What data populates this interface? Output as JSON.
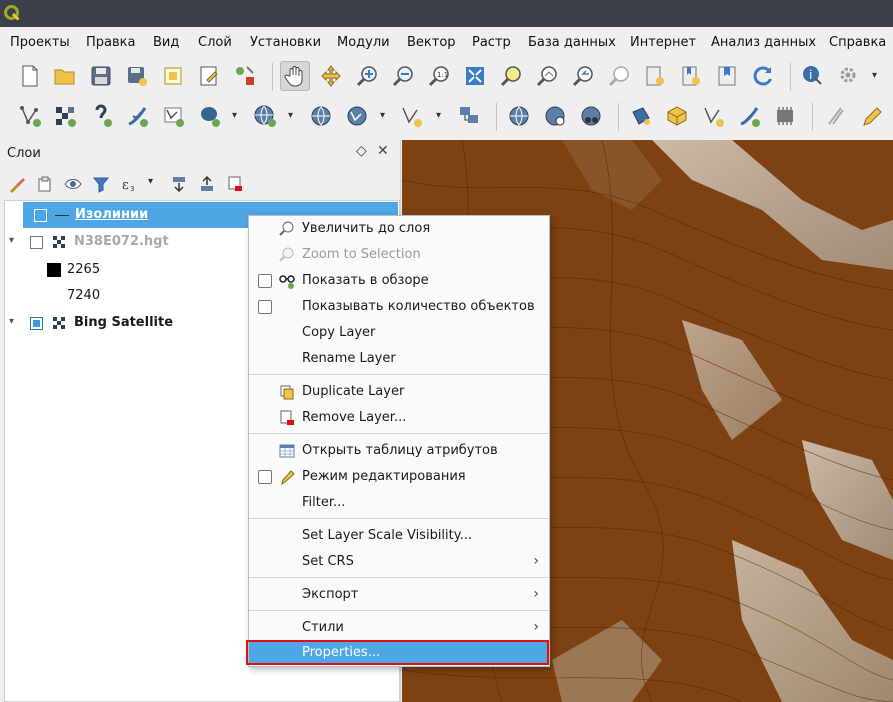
{
  "menubar": {
    "items": [
      "Проекты",
      "Правка",
      "Вид",
      "Слой",
      "Установки",
      "Модули",
      "Вектор",
      "Растр",
      "База данных",
      "Интернет",
      "Анализ данных",
      "Справка"
    ]
  },
  "toolbar1": {
    "icons": [
      "new-project-icon",
      "open-project-icon",
      "save-project-icon",
      "save-as-icon",
      "new-print-layout-icon",
      "layout-manager-icon",
      "style-manager-icon",
      "pan-icon",
      "pan-to-selection-icon",
      "zoom-in-icon",
      "zoom-out-icon",
      "zoom-native-icon",
      "zoom-full-icon",
      "zoom-selection-icon",
      "zoom-layer-icon",
      "zoom-last-icon",
      "zoom-next-icon",
      "new-bookmark-icon",
      "show-bookmarks-icon",
      "refresh-icon",
      "identify-icon",
      "settings-icon"
    ]
  },
  "toolbar2": {
    "icons": [
      "add-vector-layer-icon",
      "add-raster-layer-icon",
      "add-delimited-text-icon",
      "add-spatialite-icon",
      "add-virtual-layer-icon",
      "add-postgis-icon",
      "add-wms-icon",
      "add-wfs-icon",
      "add-wcs-icon",
      "add-wfs-layer-icon",
      "new-shapefile-icon",
      "add-xyz-icon",
      "add-ogc-api-icon",
      "add-arcgis-icon",
      "add-sensor-icon",
      "add-layer-definition-icon",
      "digitize-icon",
      "edit-icon",
      "toggle-editing-icon",
      "save-edits-icon",
      "digitize-line-icon"
    ]
  },
  "layers_panel": {
    "title": "Слои",
    "layers": [
      {
        "name": "Изолинии",
        "checked": false,
        "selected": true
      },
      {
        "name": "N38E072.hgt",
        "checked": false,
        "selected": false
      },
      {
        "name": "2265",
        "legend_color": "#000000"
      },
      {
        "name": "7240",
        "legend_color": "#ffffff"
      },
      {
        "name": "Bing Satellite",
        "checked": true,
        "selected": false
      }
    ]
  },
  "context_menu": {
    "items": [
      {
        "label": "Увеличить до слоя",
        "icon": "zoom-layer-icon"
      },
      {
        "label": "Zoom to Selection",
        "icon": "zoom-selection-icon",
        "disabled": true
      },
      {
        "label": "Показать в обзоре",
        "icon": "overview-icon",
        "checkbox": true
      },
      {
        "label": "Показывать количество объектов",
        "checkbox": true
      },
      {
        "label": "Copy Layer"
      },
      {
        "label": "Rename Layer"
      },
      {
        "label": "Duplicate Layer",
        "icon": "duplicate-layer-icon"
      },
      {
        "label": "Remove Layer...",
        "icon": "remove-layer-icon"
      },
      {
        "label": "Открыть таблицу атрибутов",
        "icon": "attribute-table-icon"
      },
      {
        "label": "Режим редактирования",
        "icon": "pencil-icon",
        "checkbox": true
      },
      {
        "label": "Filter..."
      },
      {
        "label": "Set Layer Scale Visibility..."
      },
      {
        "label": "Set CRS",
        "submenu": true
      },
      {
        "label": "Экспорт",
        "submenu": true
      },
      {
        "label": "Стили",
        "submenu": true
      },
      {
        "label": "Properties...",
        "highlighted": true
      }
    ]
  }
}
